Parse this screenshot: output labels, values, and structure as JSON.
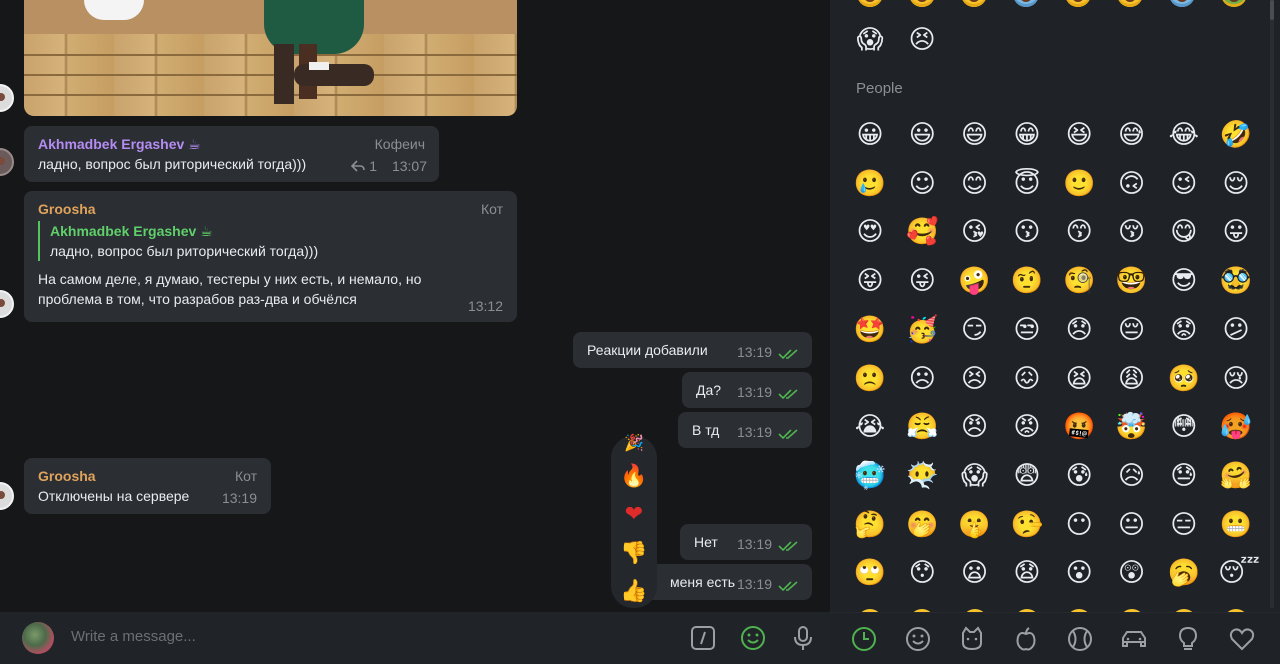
{
  "chat": {
    "messages": [
      {
        "sender": "Akhmadbek Ergashev ☕",
        "role": "Кофеич",
        "text": "ладно, вопрос был риторический тогда)))",
        "reply_count": "1",
        "time": "13:07"
      },
      {
        "sender": "Groosha",
        "role": "Кот",
        "reply_sender": "Akhmadbek Ergashev ☕",
        "reply_text": "ладно, вопрос был риторический тогда)))",
        "text_line1": "На самом деле, я думаю, тестеры у них есть, и немало, но",
        "text_line2": "проблема в том, что разрабов раз-два и обчёлся",
        "time": "13:12"
      },
      {
        "text": "Реакции добавили",
        "time": "13:19"
      },
      {
        "text": "Да?",
        "time": "13:19"
      },
      {
        "text": "В тд",
        "time": "13:19"
      },
      {
        "sender": "Groosha",
        "role": "Кот",
        "text": "Отключены на сервере",
        "time": "13:19"
      },
      {
        "text": "Нет",
        "time": "13:19"
      },
      {
        "text": "меня есть",
        "time": "13:19"
      }
    ],
    "reactions": [
      "🎉",
      "🔥",
      "❤",
      "👎",
      "👍"
    ]
  },
  "input": {
    "placeholder": "Write a message..."
  },
  "emoji_panel": {
    "section_title": "People",
    "top_row": [
      "😱",
      "😣"
    ],
    "grid": [
      [
        "😀",
        "😃",
        "😄",
        "😁",
        "😆",
        "😅",
        "😂",
        "🤣"
      ],
      [
        "🥲",
        "☺",
        "😊",
        "😇",
        "🙂",
        "🙃",
        "😉",
        "😌"
      ],
      [
        "😍",
        "🥰",
        "😘",
        "😗",
        "😙",
        "😚",
        "😋",
        "😛"
      ],
      [
        "😝",
        "😜",
        "🤪",
        "🤨",
        "🧐",
        "🤓",
        "😎",
        "🥸"
      ],
      [
        "🤩",
        "🥳",
        "😏",
        "😒",
        "😞",
        "😔",
        "😟",
        "😕"
      ],
      [
        "🙁",
        "☹",
        "😣",
        "😖",
        "😫",
        "😩",
        "🥺",
        "😢"
      ],
      [
        "😭",
        "😤",
        "😠",
        "😡",
        "🤬",
        "🤯",
        "😳",
        "🥵"
      ],
      [
        "🥶",
        "😶‍🌫️",
        "😱",
        "😨",
        "😰",
        "😥",
        "😓",
        "🤗"
      ],
      [
        "🤔",
        "🤭",
        "🤫",
        "🤥",
        "😶",
        "😐",
        "😑",
        "😬"
      ],
      [
        "🙄",
        "😯",
        "😦",
        "😧",
        "😮",
        "😲",
        "🥱",
        "😴"
      ]
    ],
    "tabs": [
      "recent-icon",
      "smile-icon",
      "cat-icon",
      "apple-icon",
      "ball-icon",
      "car-icon",
      "bulb-icon",
      "heart-icon"
    ]
  },
  "colors": {
    "sender_purple": "#b48cf2",
    "sender_orange": "#e0a35c",
    "reply_green": "#5fd06a",
    "check_green": "#4fb34f",
    "accent": "#4fb34f"
  }
}
